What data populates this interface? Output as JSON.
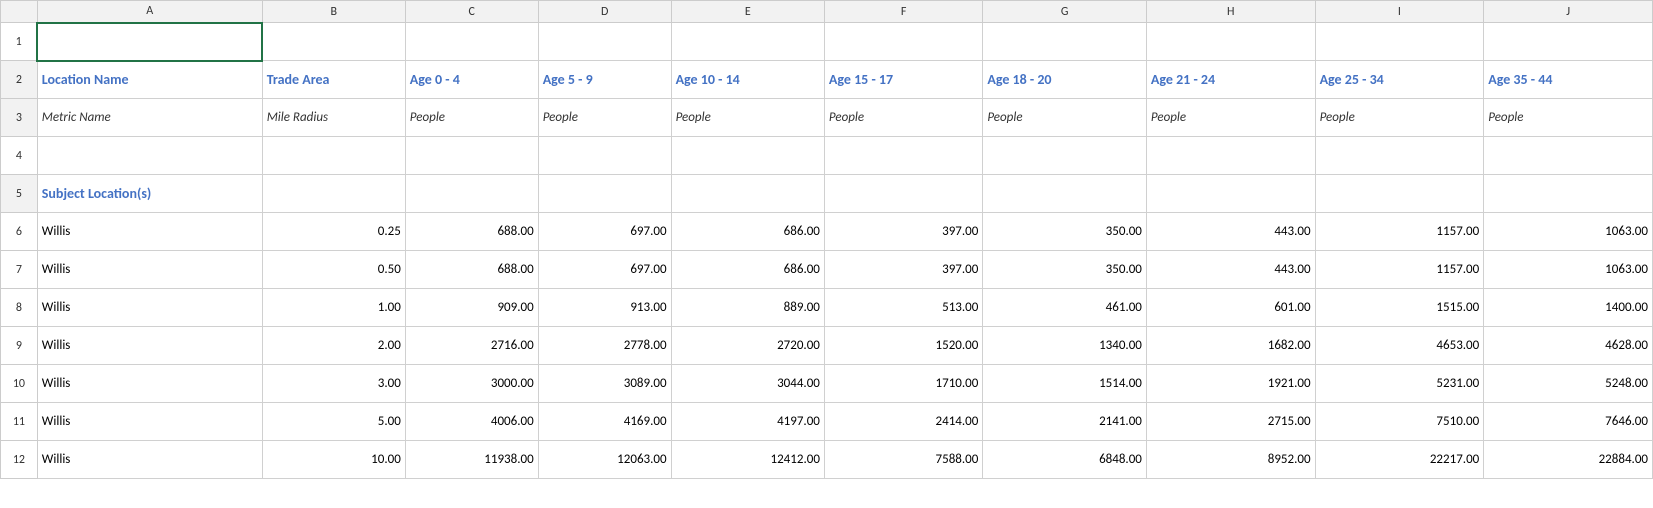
{
  "columns": {
    "letters": [
      "",
      "A",
      "B",
      "C",
      "D",
      "E",
      "F",
      "G",
      "H",
      "I",
      "J"
    ],
    "rownum_label": ""
  },
  "rows": {
    "row1": {
      "num": "1",
      "cells": [
        "",
        "",
        "",
        "",
        "",
        "",
        "",
        "",
        "",
        ""
      ]
    },
    "row2": {
      "num": "2",
      "cells": [
        "Location Name",
        "Trade Area",
        "Age 0 - 4",
        "Age 5 - 9",
        "Age 10 - 14",
        "Age 15 - 17",
        "Age 18 - 20",
        "Age 21 - 24",
        "Age 25 - 34",
        "Age 35 - 44"
      ]
    },
    "row3": {
      "num": "3",
      "cells": [
        "Metric Name",
        "Mile Radius",
        "People",
        "People",
        "People",
        "People",
        "People",
        "People",
        "People",
        "People"
      ]
    },
    "row4": {
      "num": "4",
      "cells": [
        "",
        "",
        "",
        "",
        "",
        "",
        "",
        "",
        "",
        ""
      ]
    },
    "row5": {
      "num": "5",
      "cells": [
        "Subject Location(s)",
        "",
        "",
        "",
        "",
        "",
        "",
        "",
        "",
        ""
      ]
    },
    "row6": {
      "num": "6",
      "cells": [
        "Willis",
        "0.25",
        "688.00",
        "697.00",
        "686.00",
        "397.00",
        "350.00",
        "443.00",
        "1157.00",
        "1063.00"
      ]
    },
    "row7": {
      "num": "7",
      "cells": [
        "Willis",
        "0.50",
        "688.00",
        "697.00",
        "686.00",
        "397.00",
        "350.00",
        "443.00",
        "1157.00",
        "1063.00"
      ]
    },
    "row8": {
      "num": "8",
      "cells": [
        "Willis",
        "1.00",
        "909.00",
        "913.00",
        "889.00",
        "513.00",
        "461.00",
        "601.00",
        "1515.00",
        "1400.00"
      ]
    },
    "row9": {
      "num": "9",
      "cells": [
        "Willis",
        "2.00",
        "2716.00",
        "2778.00",
        "2720.00",
        "1520.00",
        "1340.00",
        "1682.00",
        "4653.00",
        "4628.00"
      ]
    },
    "row10": {
      "num": "10",
      "cells": [
        "Willis",
        "3.00",
        "3000.00",
        "3089.00",
        "3044.00",
        "1710.00",
        "1514.00",
        "1921.00",
        "5231.00",
        "5248.00"
      ]
    },
    "row11": {
      "num": "11",
      "cells": [
        "Willis",
        "5.00",
        "4006.00",
        "4169.00",
        "4197.00",
        "2414.00",
        "2141.00",
        "2715.00",
        "7510.00",
        "7646.00"
      ]
    },
    "row12": {
      "num": "12",
      "cells": [
        "Willis",
        "10.00",
        "11938.00",
        "12063.00",
        "12412.00",
        "7588.00",
        "6848.00",
        "8952.00",
        "22217.00",
        "22884.00"
      ]
    }
  },
  "colors": {
    "blue": "#4472C4",
    "header_bg": "#f2f2f2",
    "border": "#d0d0d0",
    "selected_border": "#217346"
  }
}
